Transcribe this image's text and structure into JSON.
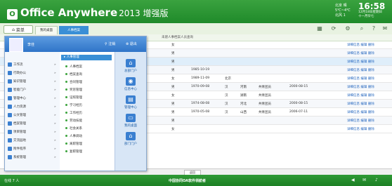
{
  "header": {
    "logo_glyph": "O",
    "app_title": "Office Anywhere",
    "version": "2013 增强版",
    "weather_city": "北京",
    "weather_info": "晴",
    "weather_temp": "5℃~4℃",
    "weather_wind": "北风 1",
    "clock": "16:58",
    "date": "12月18日星期日",
    "date2": "十一月廿七",
    "weekday": "日"
  },
  "tabbar": {
    "menu_label": "菜单",
    "tabs": [
      "我的桌面",
      "人事档案"
    ],
    "icons": [
      "apps-icon",
      "refresh-icon",
      "settings-icon",
      "search-icon",
      "help-icon",
      "mail-icon"
    ]
  },
  "subbar": {
    "title": "未建人事档案人员查询"
  },
  "table": {
    "rows": [
      {
        "a": "女",
        "b": "",
        "c": "",
        "d": "",
        "e": "",
        "f": "",
        "act": "详细信息  编辑  删除"
      },
      {
        "a": "男",
        "b": "",
        "c": "",
        "d": "",
        "e": "",
        "f": "",
        "act": "详细信息  编辑  删除"
      },
      {
        "a": "男",
        "b": "",
        "c": "",
        "d": "",
        "e": "",
        "f": "",
        "act": "详细信息  编辑  删除"
      },
      {
        "a": "男",
        "b": "1985-10-19",
        "c": "",
        "d": "",
        "e": "",
        "f": "",
        "act": "详细信息  编辑  删除"
      },
      {
        "a": "女",
        "b": "1989-11-09",
        "c": "北京",
        "d": "",
        "e": "",
        "f": "",
        "act": "详细信息  编辑  删除"
      },
      {
        "a": "男",
        "b": "1970-09-08",
        "c": "汉",
        "d": "河南",
        "e": "共青团员",
        "f": "2000-08-15",
        "act": "详细信息  编辑  删除"
      },
      {
        "a": "女",
        "b": "",
        "c": "汉",
        "d": "湖南",
        "e": "共青团员",
        "f": "",
        "act": "详细信息  编辑  删除"
      },
      {
        "a": "男",
        "b": "1974-08-08",
        "c": "汉",
        "d": "河北",
        "e": "共青团员",
        "f": "2000-08-15",
        "act": "详细信息  编辑  删除"
      },
      {
        "a": "男",
        "b": "1970-05-08",
        "c": "汉",
        "d": "山西",
        "e": "共青团员",
        "f": "2006-07-11",
        "act": "详细信息  编辑  删除"
      },
      {
        "a": "男",
        "b": "",
        "c": "",
        "d": "",
        "e": "",
        "f": "",
        "act": "详细信息  编辑  删除"
      },
      {
        "a": "女",
        "b": "",
        "c": "",
        "d": "",
        "e": "",
        "f": "",
        "act": "详细信息  编辑  删除"
      }
    ]
  },
  "pager": {
    "back": "返回"
  },
  "footer": {
    "left": "在线 7 人",
    "center": "中国协同OA软件领航者"
  },
  "start_menu": {
    "user": "李佳",
    "logout": "注销",
    "exit": "退出",
    "categories": [
      "工作流",
      "行政办公",
      "知识管理",
      "智能门户",
      "管理中心",
      "人力资源",
      "公文管理",
      "档案管理",
      "项目管理",
      "交流园地",
      "附件程序",
      "系统管理"
    ],
    "section_title": "人事管理",
    "items": [
      "人事档案",
      "档案查询",
      "合同管理",
      "奖惩管理",
      "证照管理",
      "学习经历",
      "工作经历",
      "劳动技能",
      "社会关系",
      "人事调动",
      "离职管理",
      "复职管理"
    ],
    "quick": [
      "总部门户",
      "信息中心",
      "管理中心",
      "我的桌面",
      "部门门户"
    ]
  }
}
